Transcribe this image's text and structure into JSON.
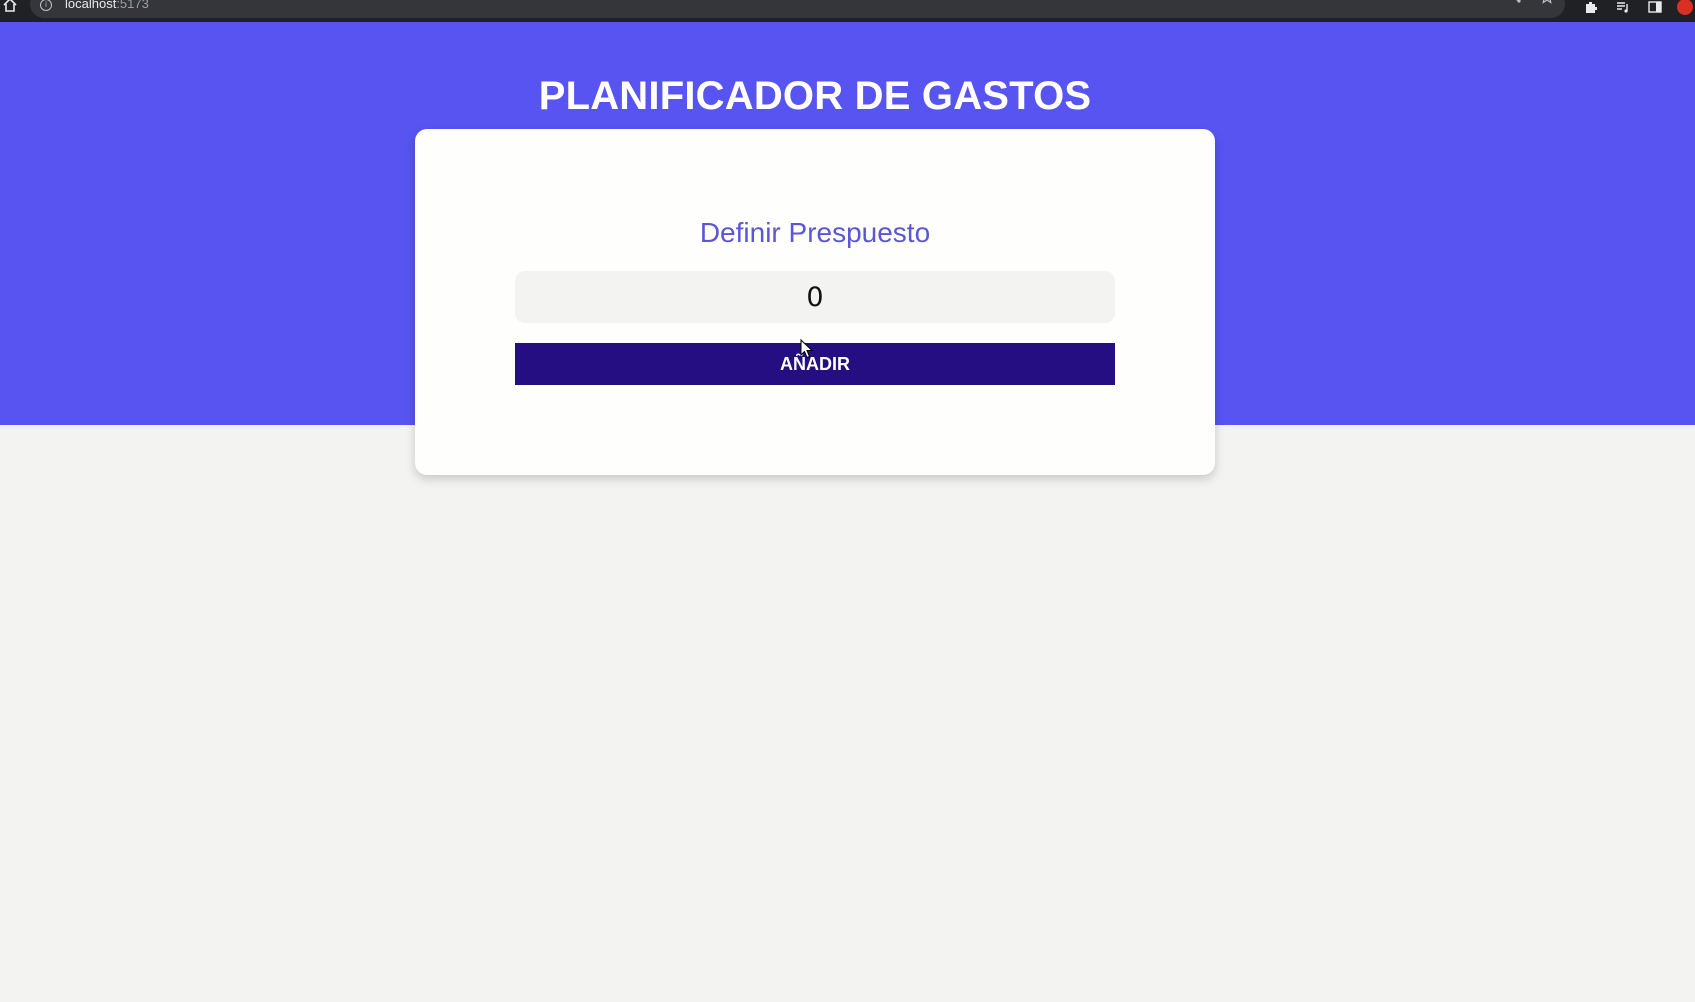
{
  "browser": {
    "url_host": "localhost",
    "url_port": ":5173",
    "icons": [
      "home-icon",
      "info-icon",
      "share-icon",
      "star-icon",
      "extensions-icon",
      "media-icon",
      "sidepanel-icon",
      "avatar-icon"
    ]
  },
  "header": {
    "title": "PLANIFICADOR DE GASTOS"
  },
  "budget_form": {
    "label": "Definir Prespuesto",
    "input_value": "0",
    "submit_label": "AÑADIR"
  },
  "colors": {
    "header_background": "#5754f2",
    "page_background": "#f3f3f1",
    "label_text": "#5b56d8",
    "button_background": "#250e82"
  }
}
